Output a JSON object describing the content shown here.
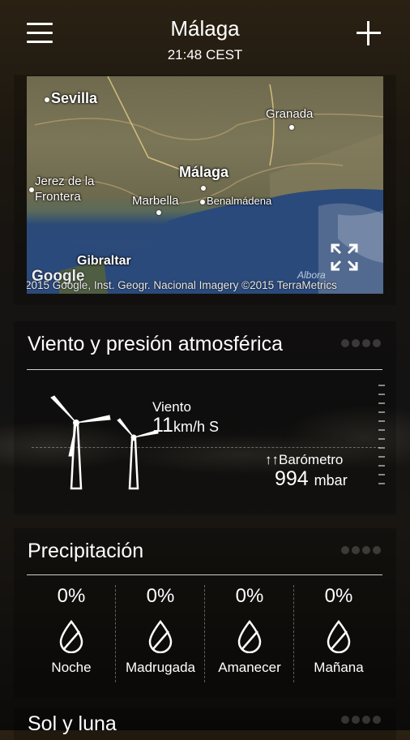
{
  "header": {
    "city": "Málaga",
    "time": "21:48 CEST"
  },
  "map": {
    "labels": {
      "sevilla": "Sevilla",
      "granada": "Granada",
      "jerez_line1": "Jerez de la",
      "jerez_line2": "Frontera",
      "malaga": "Málaga",
      "marbella": "Marbella",
      "benalmadena": "Benalmádena",
      "gibraltar": "Gibraltar",
      "alboran": "Albora"
    },
    "google_logo": "Google",
    "attribution": "2015 Google, Inst. Geogr. Nacional  Imagery ©2015 TerraMetrics"
  },
  "wind": {
    "title": "Viento y presión atmosférica",
    "wind_label": "Viento",
    "wind_value": "11",
    "wind_unit": "km/h S",
    "barometer_label": "↑↑Barómetro",
    "barometer_value": "994",
    "barometer_unit": "mbar"
  },
  "precipitation": {
    "title": "Precipitación",
    "periods": [
      {
        "percent": "0%",
        "label": "Noche"
      },
      {
        "percent": "0%",
        "label": "Madrugada"
      },
      {
        "percent": "0%",
        "label": "Amanecer"
      },
      {
        "percent": "0%",
        "label": "Mañana"
      }
    ]
  },
  "sun_moon": {
    "title": "Sol y luna"
  }
}
